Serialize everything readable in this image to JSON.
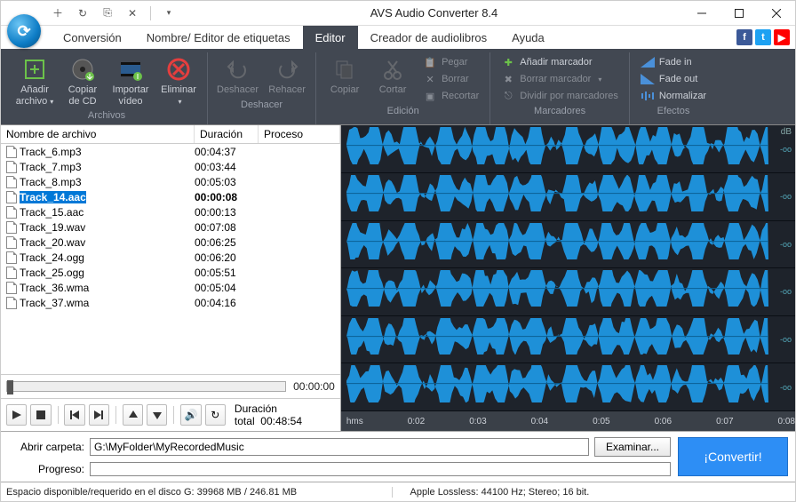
{
  "title": "AVS Audio Converter 8.4",
  "tabs": [
    "Conversión",
    "Nombre/ Editor de etiquetas",
    "Editor",
    "Creador de audiolibros",
    "Ayuda"
  ],
  "active_tab": 2,
  "ribbon": {
    "group_files": "Archivos",
    "group_undo": "Deshacer",
    "group_edit": "Edición",
    "group_markers": "Marcadores",
    "group_effects": "Efectos",
    "add_file": "Añadir\narchivo",
    "copy_cd": "Copiar\nde CD",
    "import_video": "Importar\nvídeo",
    "delete": "Eliminar",
    "undo": "Deshacer",
    "redo": "Rehacer",
    "copy": "Copiar",
    "cut": "Cortar",
    "paste": "Pegar",
    "erase": "Borrar",
    "trim": "Recortar",
    "add_marker": "Añadir marcador",
    "del_marker": "Borrar marcador",
    "split_markers": "Dividir por marcadores",
    "fade_in": "Fade in",
    "fade_out": "Fade out",
    "normalize": "Normalizar"
  },
  "columns": {
    "name": "Nombre de archivo",
    "dur": "Duración",
    "proc": "Proceso"
  },
  "files": [
    {
      "name": "Track_6.mp3",
      "dur": "00:04:37"
    },
    {
      "name": "Track_7.mp3",
      "dur": "00:03:44"
    },
    {
      "name": "Track_8.mp3",
      "dur": "00:05:03"
    },
    {
      "name": "Track_14.aac",
      "dur": "00:00:08",
      "selected": true
    },
    {
      "name": "Track_15.aac",
      "dur": "00:00:13"
    },
    {
      "name": "Track_19.wav",
      "dur": "00:07:08"
    },
    {
      "name": "Track_20.wav",
      "dur": "00:06:25"
    },
    {
      "name": "Track_24.ogg",
      "dur": "00:06:20"
    },
    {
      "name": "Track_25.ogg",
      "dur": "00:05:51"
    },
    {
      "name": "Track_36.wma",
      "dur": "00:05:04"
    },
    {
      "name": "Track_37.wma",
      "dur": "00:04:16"
    }
  ],
  "scrub_time": "00:00:00",
  "total_dur_label": "Duración total",
  "total_dur": "00:48:54",
  "timeline_unit": "hms",
  "timeline_ticks": [
    "0:02",
    "0:03",
    "0:04",
    "0:05",
    "0:06",
    "0:07",
    "0:08"
  ],
  "wave_right_label": "dB",
  "wave_val": "-oo",
  "open_folder_label": "Abrir carpeta:",
  "open_folder_value": "G:\\MyFolder\\MyRecordedMusic",
  "examine": "Examinar...",
  "progress_label": "Progreso:",
  "convert": "¡Convertir!",
  "status_left": "Espacio disponible/requerido en el disco G: 39968 MB / 246.81 MB",
  "status_right": "Apple Lossless: 44100  Hz; Stereo;  16 bit."
}
